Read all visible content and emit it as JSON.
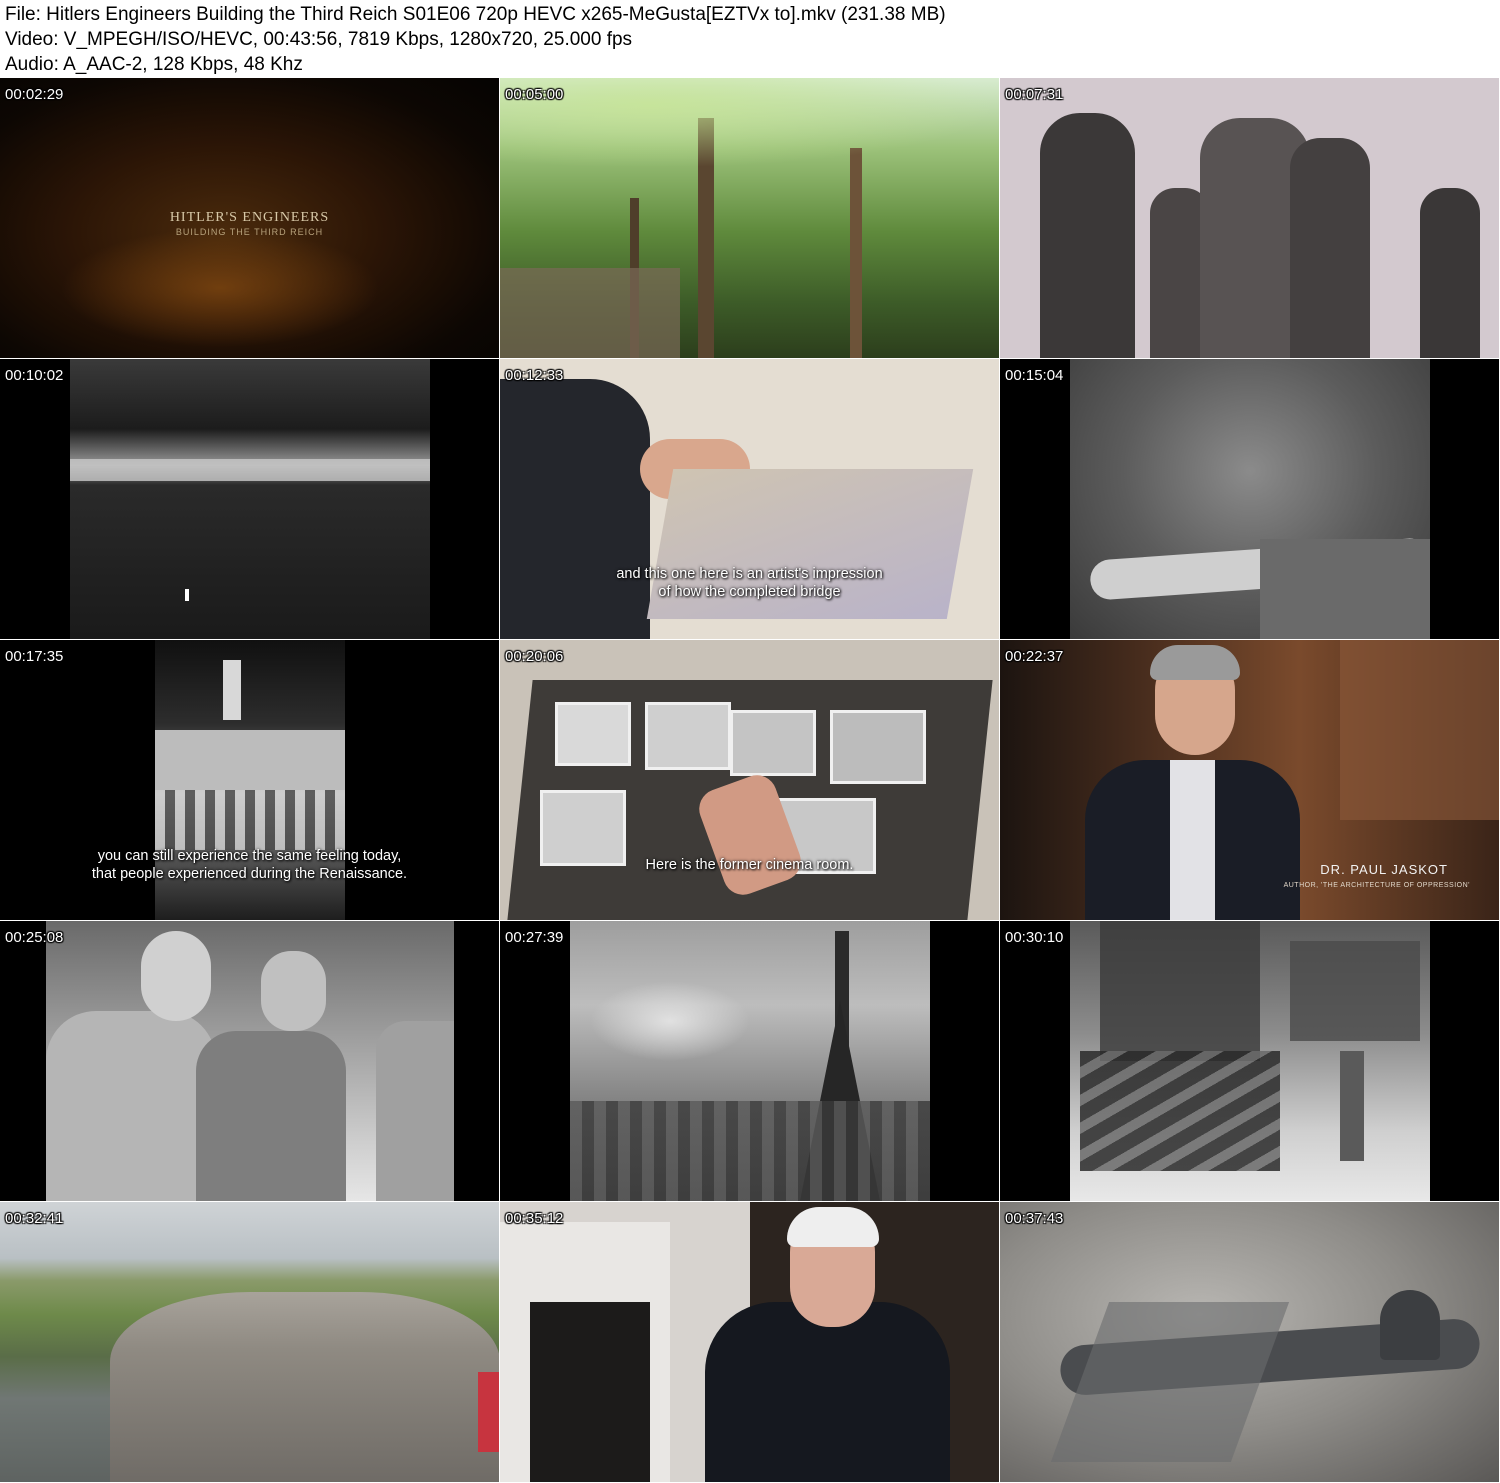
{
  "header": {
    "file_line": "File: Hitlers Engineers Building the Third Reich S01E06 720p HEVC x265-MeGusta[EZTVx to].mkv (231.38 MB)",
    "video_line": "Video: V_MPEGH/ISO/HEVC, 00:43:56, 7819 Kbps, 1280x720, 25.000 fps",
    "audio_line": "Audio: A_AAC-2, 128 Kbps, 48 Khz"
  },
  "thumbnails": [
    {
      "timestamp": "00:02:29",
      "title_main": "HITLER'S ENGINEERS",
      "title_sub": "BUILDING THE THIRD REICH"
    },
    {
      "timestamp": "00:05:00"
    },
    {
      "timestamp": "00:07:31"
    },
    {
      "timestamp": "00:10:02"
    },
    {
      "timestamp": "00:12:33",
      "subtitle_lines": [
        "and this one here is an artist's impression",
        "of how the completed bridge"
      ]
    },
    {
      "timestamp": "00:15:04"
    },
    {
      "timestamp": "00:17:35",
      "subtitle_lines": [
        "you can still experience the same feeling today,",
        "that people experienced during the Renaissance."
      ]
    },
    {
      "timestamp": "00:20:06",
      "subtitle_lines": [
        "Here is the former cinema room."
      ]
    },
    {
      "timestamp": "00:22:37",
      "lower_third_name": "DR. PAUL JASKOT",
      "lower_third_role": "AUTHOR, 'THE ARCHITECTURE OF OPPRESSION'"
    },
    {
      "timestamp": "00:25:08"
    },
    {
      "timestamp": "00:27:39"
    },
    {
      "timestamp": "00:30:10"
    },
    {
      "timestamp": "00:32:41"
    },
    {
      "timestamp": "00:35:12"
    },
    {
      "timestamp": "00:37:43"
    }
  ],
  "colors": {
    "page_bg": "#ffffff",
    "text": "#000000",
    "timestamp": "#ffffff",
    "letterbox": "#000000"
  }
}
